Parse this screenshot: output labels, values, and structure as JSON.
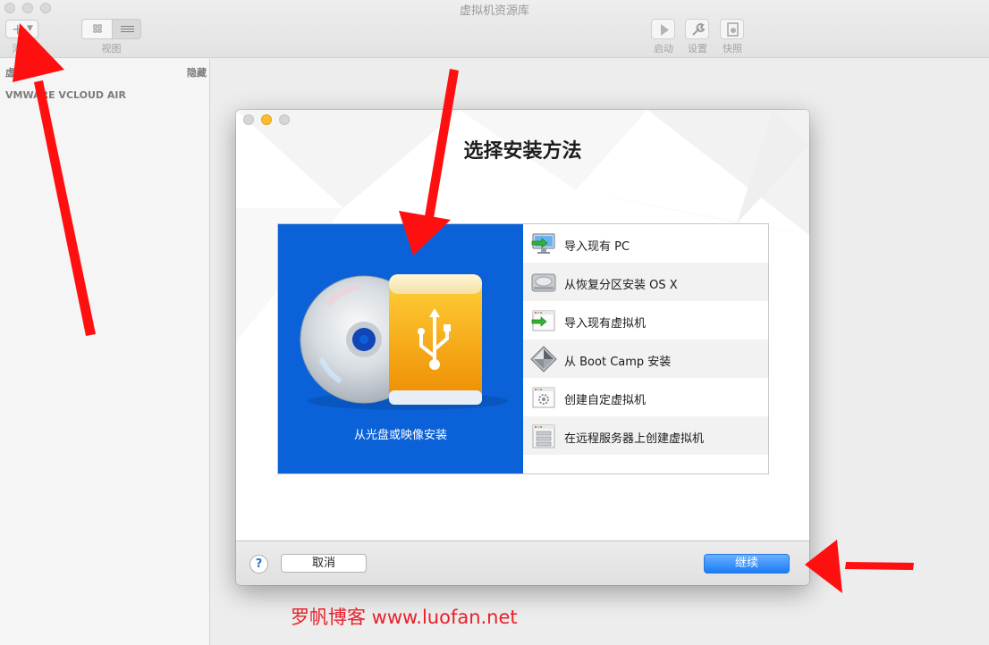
{
  "window": {
    "title": "虚拟机资源库"
  },
  "toolbar": {
    "add_label": "添加",
    "add_glyph": "+",
    "view_label": "视图",
    "start_label": "启动",
    "settings_label": "设置",
    "snapshot_label": "快照"
  },
  "sidebar": {
    "heading": "虚拟机",
    "hide_label": "隐藏",
    "item": "VMWARE VCLOUD AIR"
  },
  "dialog": {
    "title": "选择安装方法",
    "primary_option": "从光盘或映像安装",
    "options": [
      {
        "label": "导入现有 PC",
        "icon": "monitor-import-icon"
      },
      {
        "label": "从恢复分区安装 OS X",
        "icon": "hard-disk-icon"
      },
      {
        "label": "导入现有虚拟机",
        "icon": "window-import-icon"
      },
      {
        "label": "从 Boot Camp 安装",
        "icon": "bootcamp-icon"
      },
      {
        "label": "创建自定虚拟机",
        "icon": "custom-vm-icon"
      },
      {
        "label": "在远程服务器上创建虚拟机",
        "icon": "server-icon"
      }
    ],
    "help_label": "?",
    "cancel_label": "取消",
    "continue_label": "继续"
  },
  "watermark": "罗帆博客 www.luofan.net",
  "colors": {
    "panel_blue": "#0b62d8",
    "continue_blue": "#1a7cf5",
    "arrow_red": "#ff1010",
    "watermark_red": "#e8202a"
  }
}
